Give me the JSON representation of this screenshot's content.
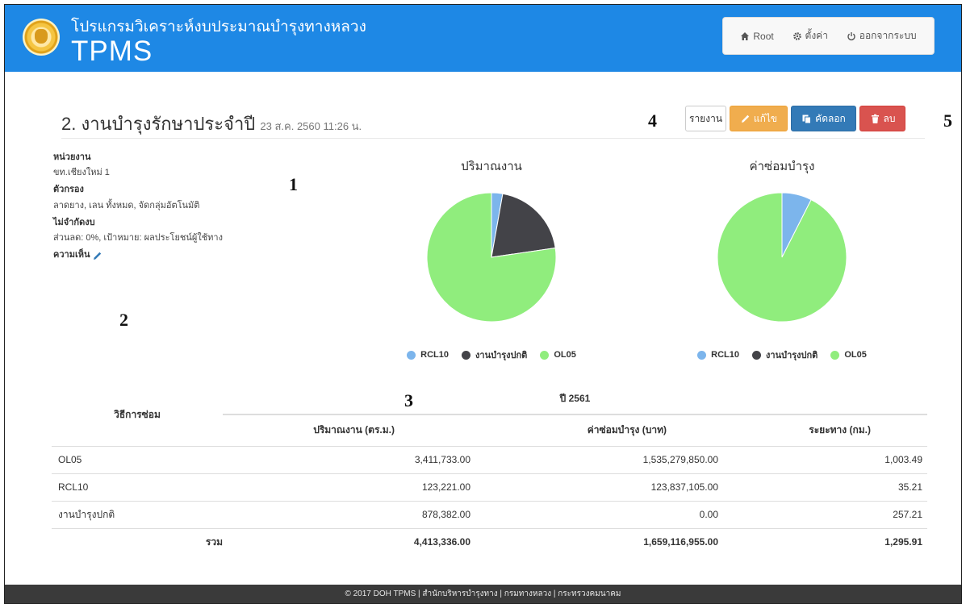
{
  "header": {
    "subtitle": "โปรแกรมวิเคราะห์งบประมาณบำรุงทางหลวง",
    "title": "TPMS",
    "nav": {
      "root": "Root",
      "settings": "ตั้งค่า",
      "logout": "ออกจากระบบ"
    }
  },
  "page": {
    "title": "2. งานบำรุงรักษาประจำปี",
    "timestamp": "23 ส.ค. 2560 11:26 น.",
    "actions": {
      "report": "รายงาน",
      "edit": "แก้ไข",
      "copy": "คัดลอก",
      "delete": "ลบ"
    }
  },
  "annotations": {
    "m1": "1",
    "m2": "2",
    "m3": "3",
    "m4": "4",
    "m5": "5"
  },
  "info": {
    "unit_label": "หน่วยงาน",
    "unit_value": "ขท.เชียงใหม่ 1",
    "filter_label": "ตัวกรอง",
    "filter_value": "ลาดยาง, เลน ทั้งหมด, จัดกลุ่มอัตโนมัติ",
    "budget_label": "ไม่จำกัดงบ",
    "budget_value": "ส่วนลด: 0%, เป้าหมาย: ผลประโยชน์ผู้ใช้ทาง",
    "comment_label": "ความเห็น"
  },
  "chart_data": [
    {
      "type": "pie",
      "title": "ปริมาณงาน",
      "categories": [
        "RCL10",
        "งานบำรุงปกติ",
        "OL05"
      ],
      "values": [
        123221.0,
        878382.0,
        3411733.0
      ],
      "colors": [
        "#7cb5ec",
        "#434348",
        "#90ed7d"
      ],
      "legend": "bottom"
    },
    {
      "type": "pie",
      "title": "ค่าซ่อมบำรุง",
      "categories": [
        "RCL10",
        "งานบำรุงปกติ",
        "OL05"
      ],
      "values": [
        123837105.0,
        0.0,
        1535279850.0
      ],
      "colors": [
        "#7cb5ec",
        "#434348",
        "#90ed7d"
      ],
      "legend": "bottom"
    }
  ],
  "table": {
    "method_header": "วิธีการซ่อม",
    "year_header": "ปี 2561",
    "columns": [
      "ปริมาณงาน (ตร.ม.)",
      "ค่าซ่อมบำรุง (บาท)",
      "ระยะทาง (กม.)"
    ],
    "rows": [
      [
        "OL05",
        "3,411,733.00",
        "1,535,279,850.00",
        "1,003.49"
      ],
      [
        "RCL10",
        "123,221.00",
        "123,837,105.00",
        "35.21"
      ],
      [
        "งานบำรุงปกติ",
        "878,382.00",
        "0.00",
        "257.21"
      ]
    ],
    "total": [
      "รวม",
      "4,413,336.00",
      "1,659,116,955.00",
      "1,295.91"
    ]
  },
  "footer": {
    "text": "© 2017 DOH TPMS | สำนักบริหารบำรุงทาง | กรมทางหลวง | กระทรวงคมนาคม"
  }
}
